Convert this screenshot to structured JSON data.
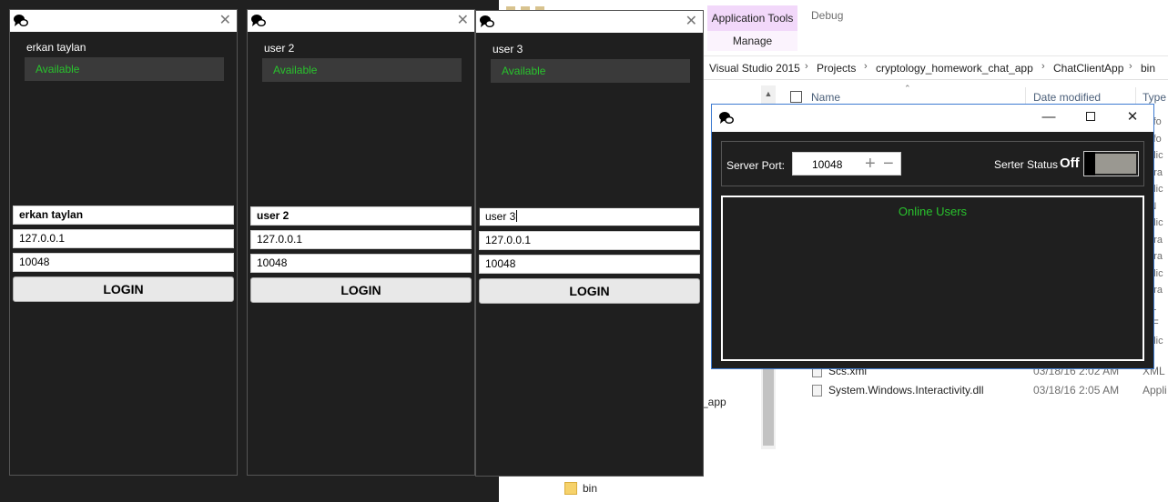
{
  "explorer": {
    "ribbon": {
      "app_tools_tab": "Application Tools",
      "manage_tab": "Manage",
      "debug_tab": "Debug"
    },
    "breadcrumb": [
      "Visual Studio 2015",
      "Projects",
      "cryptology_homework_chat_app",
      "ChatClientApp",
      "bin"
    ],
    "columns": {
      "name": "Name",
      "date_modified": "Date modified",
      "type": "Type"
    },
    "files": [
      {
        "name": "Scs.xml",
        "date": "03/18/16 2:02 AM",
        "type": "XML"
      },
      {
        "name": "System.Windows.Interactivity.dll",
        "date": "03/18/16 2:05 AM",
        "type": "Appli"
      }
    ],
    "type_fragments": [
      "le fo",
      "le fo",
      "pplic",
      "ogra",
      "pplic",
      "AN",
      "pplic",
      "ogra",
      "ogra",
      "pplic",
      "ogra",
      "ML",
      "N F",
      "pplic"
    ],
    "nav": {
      "partial_item": "_app",
      "bin_folder": "bin"
    }
  },
  "clients": [
    {
      "username": "erkan taylan",
      "status": "Available",
      "username_field": "erkan taylan",
      "ip_field": "127.0.0.1",
      "port_field": "10048",
      "login_label": "LOGIN"
    },
    {
      "username": "user 2",
      "status": "Available",
      "username_field": "user 2",
      "ip_field": "127.0.0.1",
      "port_field": "10048",
      "login_label": "LOGIN"
    },
    {
      "username": "user 3",
      "status": "Available",
      "username_field": "user 3",
      "ip_field": "127.0.0.1",
      "port_field": "10048",
      "login_label": "LOGIN"
    }
  ],
  "server": {
    "port_label": "Server Port:",
    "port_value": "10048",
    "plus_icon": "+",
    "minus_icon": "−",
    "status_label": "Serter Status",
    "status_value": "Off",
    "online_users_title": "Online Users",
    "window_controls": {
      "minimize": "—",
      "close": "✕"
    }
  },
  "colors": {
    "available_green": "#29c32d",
    "window_bg": "#1f1f1f",
    "ribbon_app_tools": "#f2d8fa"
  },
  "icons": {
    "chat_icon": "chat-bubbles-icon",
    "close_icon": "close-icon"
  },
  "close_glyph": "✕"
}
